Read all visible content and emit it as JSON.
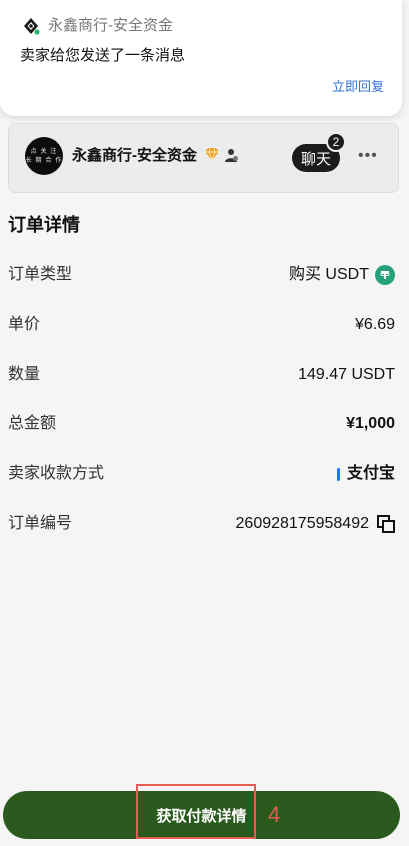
{
  "notification": {
    "app_name": "永鑫商行-安全资金",
    "message": "卖家给您发送了一条消息",
    "reply": "立即回复"
  },
  "seller": {
    "avatar_text_line1": "点 关 注",
    "avatar_text_line2": "长 期 合 作",
    "name": "永鑫商行-安全资金",
    "chat_label": "聊天",
    "unread_count": "2"
  },
  "order": {
    "title": "订单详情",
    "rows": [
      {
        "label": "订单类型",
        "value": "购买 USDT"
      },
      {
        "label": "单价",
        "value": "¥6.69"
      },
      {
        "label": "数量",
        "value": "149.47 USDT"
      },
      {
        "label": "总金额",
        "value": "¥1,000"
      },
      {
        "label": "卖家收款方式",
        "value": "支付宝"
      },
      {
        "label": "订单编号",
        "value": "260928175958492"
      }
    ]
  },
  "cta": {
    "label": "获取付款详情",
    "step_number": "4"
  },
  "colors": {
    "cta_bg": "#2b5a1e",
    "highlight": "#e35d52",
    "link": "#2f6fd6",
    "tether": "#26a17b",
    "alipay": "#1677ff"
  }
}
